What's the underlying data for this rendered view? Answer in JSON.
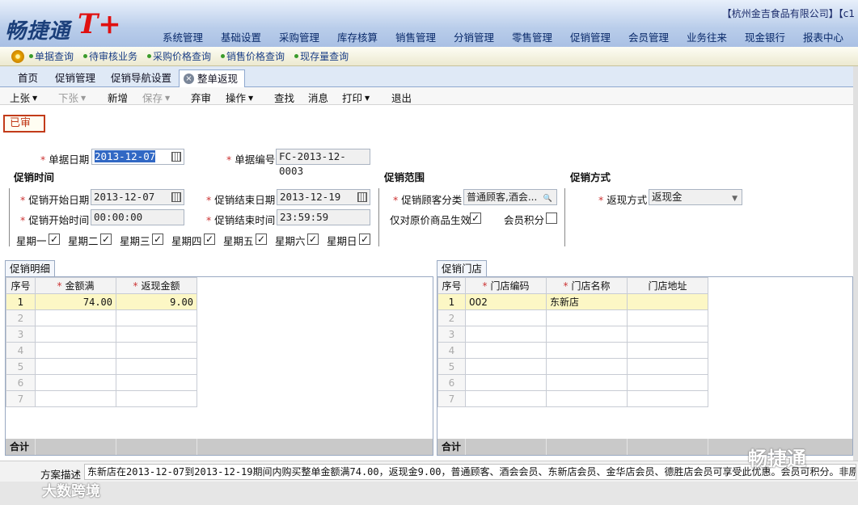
{
  "header": {
    "logo": "畅捷通",
    "logo_suffix": "T+",
    "company": "【杭州金吉食品有限公司】【c1",
    "menu": [
      "系统管理",
      "基础设置",
      "采购管理",
      "库存核算",
      "销售管理",
      "分销管理",
      "零售管理",
      "促销管理",
      "会员管理",
      "业务往来",
      "现金银行",
      "报表中心"
    ]
  },
  "quickbar": [
    "单据查询",
    "待审核业务",
    "采购价格查询",
    "销售价格查询",
    "现存量查询"
  ],
  "tabs": [
    "首页",
    "促销管理",
    "促销导航设置",
    "整单返现"
  ],
  "toolbar": {
    "up": "上张",
    "down": "下张",
    "add": "新增",
    "save": "保存",
    "abandon": "弃审",
    "operate": "操作",
    "find": "查找",
    "message": "消息",
    "print": "打印",
    "exit": "退出"
  },
  "status_badge": "已审",
  "form": {
    "doc_date_label": "单据日期",
    "doc_date": "2013-12-07",
    "doc_no_label": "单据编号",
    "doc_no": "FC-2013-12-0003",
    "promo_time": "促销时间",
    "promo_scope": "促销范围",
    "promo_method": "促销方式",
    "start_date_label": "促销开始日期",
    "start_date": "2013-12-07",
    "end_date_label": "促销结束日期",
    "end_date": "2013-12-19",
    "start_time_label": "促销开始时间",
    "start_time": "00:00:00",
    "end_time_label": "促销结束时间",
    "end_time": "23:59:59",
    "customer_class_label": "促销顾客分类",
    "customer_class": "普通顾客,酒会...",
    "orig_price_label": "仅对原价商品生效",
    "orig_price_checked": true,
    "member_points_label": "会员积分",
    "member_points_checked": false,
    "refund_method_label": "返现方式",
    "refund_method": "返现金",
    "weekdays": [
      {
        "label": "星期一",
        "checked": true
      },
      {
        "label": "星期二",
        "checked": true
      },
      {
        "label": "星期三",
        "checked": true
      },
      {
        "label": "星期四",
        "checked": true
      },
      {
        "label": "星期五",
        "checked": true
      },
      {
        "label": "星期六",
        "checked": true
      },
      {
        "label": "星期日",
        "checked": true
      }
    ]
  },
  "detail": {
    "tab": "促销明细",
    "headers": [
      "序号",
      "金额满",
      "返现金额"
    ],
    "rows": [
      [
        "1",
        "74.00",
        "9.00"
      ],
      [
        "2",
        "",
        ""
      ],
      [
        "3",
        "",
        ""
      ],
      [
        "4",
        "",
        ""
      ],
      [
        "5",
        "",
        ""
      ],
      [
        "6",
        "",
        ""
      ],
      [
        "7",
        "",
        ""
      ]
    ],
    "total_label": "合计"
  },
  "stores": {
    "tab": "促销门店",
    "headers": [
      "序号",
      "门店编码",
      "门店名称",
      "门店地址"
    ],
    "rows": [
      [
        "1",
        "002",
        "东新店",
        ""
      ],
      [
        "2",
        "",
        "",
        ""
      ],
      [
        "3",
        "",
        "",
        ""
      ],
      [
        "4",
        "",
        "",
        ""
      ],
      [
        "5",
        "",
        "",
        ""
      ],
      [
        "6",
        "",
        "",
        ""
      ],
      [
        "7",
        "",
        "",
        ""
      ]
    ],
    "total_label": "合计"
  },
  "description": {
    "label": "方案描述",
    "value": "东新店在2013-12-07到2013-12-19期间内购买整单金额满74.00，返现金9.00，普通顾客、酒会会员、东新店会员、金华店会员、德胜店会员可享受此优惠。会员可积分。非原"
  },
  "watermarks": {
    "right": "畅捷通",
    "left": "大数跨境"
  }
}
